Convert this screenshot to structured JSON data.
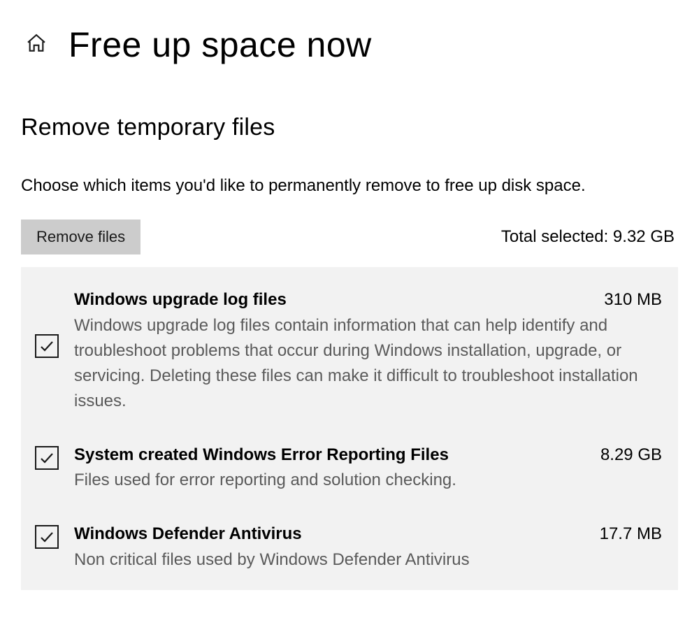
{
  "header": {
    "title": "Free up space now"
  },
  "section": {
    "title": "Remove temporary files",
    "subtitle": "Choose which items you'd like to permanently remove to free up disk space."
  },
  "action": {
    "remove_button_label": "Remove files",
    "total_selected_label": "Total selected: 9.32 GB"
  },
  "items": [
    {
      "title": "Windows upgrade log files",
      "size": "310 MB",
      "description": "Windows upgrade log files contain information that can help identify and troubleshoot problems that occur during Windows installation, upgrade, or servicing.  Deleting these files can make it difficult to troubleshoot installation issues.",
      "checked": true
    },
    {
      "title": "System created Windows Error Reporting Files",
      "size": "8.29 GB",
      "description": "Files used for error reporting and solution checking.",
      "checked": true
    },
    {
      "title": "Windows Defender Antivirus",
      "size": "17.7 MB",
      "description": "Non critical files used by Windows Defender Antivirus",
      "checked": true
    }
  ]
}
